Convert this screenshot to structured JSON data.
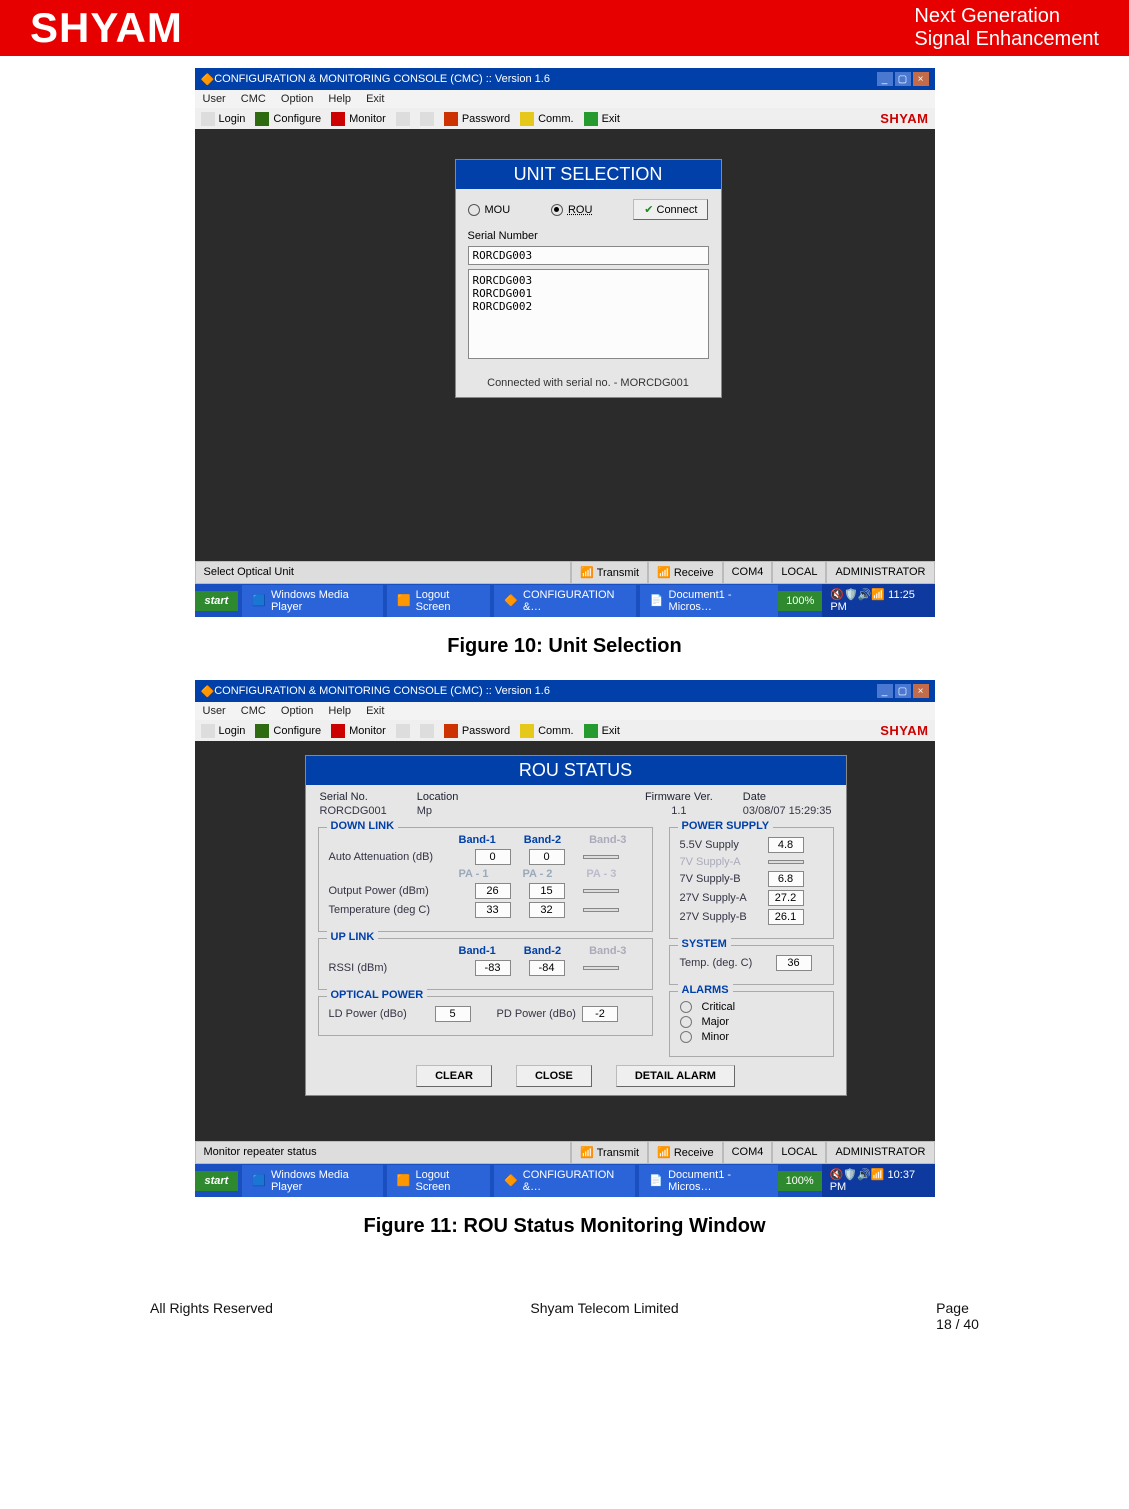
{
  "branding": {
    "logo": "SHYAM",
    "tag1": "Next Generation",
    "tag2": "Signal Enhancement",
    "tb_logo": "SHYAM"
  },
  "captions": {
    "fig10": "Figure 10: Unit Selection",
    "fig11": "Figure 11: ROU Status Monitoring Window"
  },
  "window": {
    "title": "CONFIGURATION & MONITORING CONSOLE (CMC) :: Version 1.6",
    "menu": [
      "User",
      "CMC",
      "Option",
      "Help",
      "Exit"
    ],
    "toolbar": [
      "Login",
      "Configure",
      "Monitor",
      "",
      "",
      "Password",
      "Comm.",
      "Exit"
    ]
  },
  "unit_selection": {
    "title": "UNIT SELECTION",
    "opt_mou": "MOU",
    "opt_rou": "ROU",
    "btn_connect": "Connect",
    "serial_lbl": "Serial Number",
    "serial_val": "RORCDG003",
    "list": "RORCDG003\nRORCDG001\nRORCDG002",
    "status": "Connected with serial no. - MORCDG001"
  },
  "statusbar1": {
    "left": "Select Optical Unit",
    "transmit": "Transmit",
    "receive": "Receive",
    "com": "COM4",
    "mode": "LOCAL",
    "user": "ADMINISTRATOR"
  },
  "taskbar": {
    "start": "start",
    "apps": [
      "Windows Media Player",
      "Logout Screen",
      "CONFIGURATION &…",
      "Document1 - Micros…"
    ],
    "pcnt": "100%",
    "clock": "11:25 PM"
  },
  "rou": {
    "title": "ROU STATUS",
    "top": {
      "serial_lbl": "Serial No.",
      "serial": "RORCDG001",
      "loc_lbl": "Location",
      "loc": "Mp",
      "fw_lbl": "Firmware Ver.",
      "fw": "1.1",
      "date_lbl": "Date",
      "date": "03/08/07 15:29:35"
    },
    "downlink": {
      "title": "DOWN LINK",
      "cols": [
        "Band-1",
        "Band-2",
        "Band-3"
      ],
      "rows": [
        {
          "lab": "Auto Attenuation (dB)",
          "v": [
            "0",
            "0",
            ""
          ]
        },
        {
          "lab_cols": [
            "PA - 1",
            "PA - 2",
            "PA - 3"
          ]
        },
        {
          "lab": "Output Power (dBm)",
          "v": [
            "26",
            "15",
            ""
          ]
        },
        {
          "lab": "Temperature (deg C)",
          "v": [
            "33",
            "32",
            ""
          ]
        }
      ]
    },
    "uplink": {
      "title": "UP LINK",
      "cols": [
        "Band-1",
        "Band-2",
        "Band-3"
      ],
      "row_lab": "RSSI (dBm)",
      "row_v": [
        "-83",
        "-84",
        ""
      ]
    },
    "optical": {
      "title": "OPTICAL POWER",
      "ld_lbl": "LD Power (dBo)",
      "ld": "5",
      "pd_lbl": "PD Power (dBo)",
      "pd": "-2"
    },
    "power": {
      "title": "POWER SUPPLY",
      "rows": [
        {
          "lab": "5.5V Supply",
          "v": "4.8"
        },
        {
          "lab": "7V Supply-A",
          "v": ""
        },
        {
          "lab": "7V Supply-B",
          "v": "6.8"
        },
        {
          "lab": "27V Supply-A",
          "v": "27.2"
        },
        {
          "lab": "27V Supply-B",
          "v": "26.1"
        }
      ]
    },
    "system": {
      "title": "SYSTEM",
      "lab": "Temp. (deg. C)",
      "v": "36"
    },
    "alarms": {
      "title": "ALARMS",
      "rows": [
        "Critical",
        "Major",
        "Minor"
      ]
    },
    "buttons": {
      "clear": "CLEAR",
      "close": "CLOSE",
      "detail": "DETAIL ALARM"
    }
  },
  "statusbar2": {
    "left": "Monitor repeater status"
  },
  "taskbar2": {
    "clock": "10:37 PM"
  },
  "footer": {
    "left": "All Rights Reserved",
    "center": "Shyam Telecom Limited",
    "right_lbl": "Page",
    "right": "18 / 40"
  }
}
